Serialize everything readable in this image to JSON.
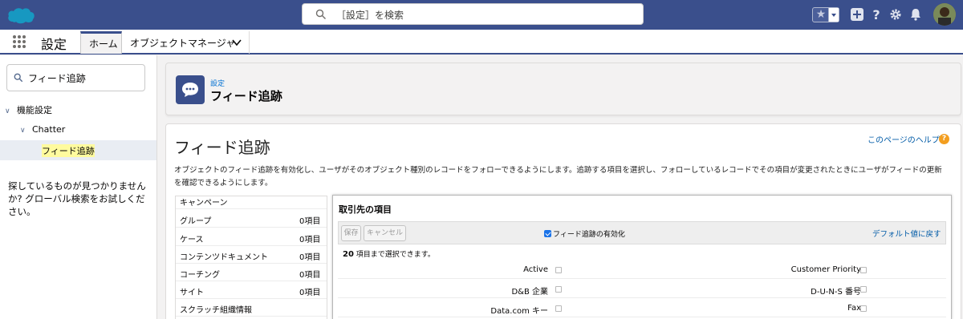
{
  "header": {
    "search_placeholder": "［設定］を検索",
    "logo_icon": "salesforce-cloud-icon",
    "colors": {
      "brand": "#3a4f8c",
      "link": "#0070d2",
      "highlight": "#fffb9e"
    }
  },
  "nav": {
    "app_name": "設定",
    "tabs": [
      {
        "label": "ホーム"
      },
      {
        "label": "オブジェクトマネージャ"
      }
    ]
  },
  "sidebar": {
    "search_value": "フィード追跡",
    "tree": {
      "level1": "機能設定",
      "level2": "Chatter",
      "selected": "フィード追跡"
    },
    "help_text": "探しているものが見つかりませんか? グローバル検索をお試しください。"
  },
  "page_header": {
    "kicker": "設定",
    "title": "フィード追跡"
  },
  "main": {
    "title": "フィード追跡",
    "help_link": "このページのヘルプ",
    "description": "オブジェクトのフィード追跡を有効化し、ユーザがそのオブジェクト種別のレコードをフォローできるようにします。追跡する項目を選択し、フォローしているレコードでその項目が変更されたときにユーザがフィードの更新を確認できるようにします。",
    "objects": [
      {
        "name": "キャンペーン",
        "count": ""
      },
      {
        "name": "グループ",
        "count": "0項目"
      },
      {
        "name": "ケース",
        "count": "0項目"
      },
      {
        "name": "コンテンツドキュメント",
        "count": "0項目"
      },
      {
        "name": "コーチング",
        "count": "0項目"
      },
      {
        "name": "サイト",
        "count": "0項目"
      },
      {
        "name": "スクラッチ組織情報",
        "count": ""
      }
    ],
    "fields_panel": {
      "title": "取引先の項目",
      "save_label": "保存",
      "cancel_label": "キャンセル",
      "enable_label": "フィード追跡の有効化",
      "enable_checked": true,
      "reset_label": "デフォルト値に戻す",
      "limit_count": "20",
      "limit_text": "項目まで選択できます。",
      "rows": [
        {
          "left": "Active",
          "right": "Customer Priority"
        },
        {
          "left": "D&B 企業",
          "right": "D-U-N-S 番号"
        },
        {
          "left": "Data.com キー",
          "right": "Fax"
        }
      ]
    }
  }
}
